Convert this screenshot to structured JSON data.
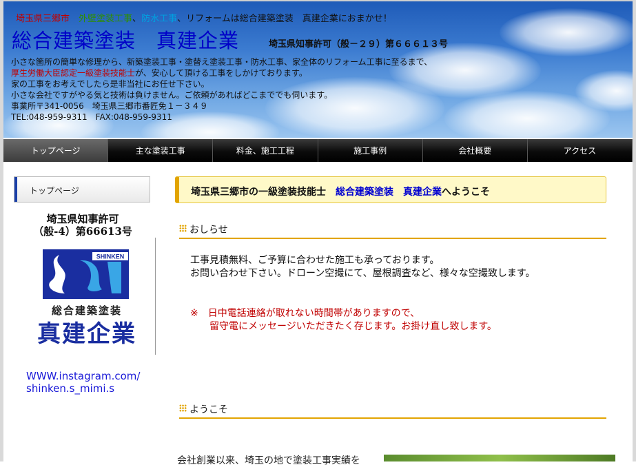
{
  "header": {
    "tagline": {
      "location": "埼玉県三郷市",
      "exterior": "外壁塗装工事",
      "waterproof": "防水工事",
      "rest": "、リフォームは総合建築塗装　真建企業におまかせ！"
    },
    "title": "総合建築塗装　真建企業",
    "license": "埼玉県知事許可（般－２９）第６６６１３号",
    "intro": {
      "line1": "小さな箇所の簡単な修理から、新築塗装工事・塗替え塗装工事・防水工事、家全体のリフォーム工事に至るまで、",
      "line2_red": "厚生労働大臣認定一級塗装技能士",
      "line2_rest": "が、安心して頂ける工事をしかけております。",
      "line3": "家の工事をお考えでしたら是非当社にお任せ下さい。",
      "line4": "小さな会社ですがやる気と技術は負けません。ご依頼があればどこまででも伺います。",
      "line5": "事業所〒341-0056　埼玉県三郷市番匠免１－３４９",
      "line6": "TEL:048-959-9311　FAX:048-959-9311"
    }
  },
  "nav": {
    "items": [
      {
        "label": "トップページ"
      },
      {
        "label": "主な塗装工事"
      },
      {
        "label": "料金、施工工程"
      },
      {
        "label": "施工事例"
      },
      {
        "label": "会社概要"
      },
      {
        "label": "アクセス"
      }
    ]
  },
  "sidebar": {
    "menu_item": "トップページ",
    "license_line1": "埼玉県知事許可",
    "license_line2": "（般-4）第66613号",
    "logo": {
      "brand": "SHINKEN",
      "subtitle": "総合建築塗装",
      "name": "真建企業"
    },
    "instagram_line1": "WWW.instagram.com/",
    "instagram_line2": "shinken.s_mimi.s"
  },
  "main": {
    "welcome": {
      "prefix": "埼玉県三郷市の一級塗装技能士　",
      "company": "総合建築塗装　真建企業",
      "suffix": "へようこそ"
    },
    "news_heading": "おしらせ",
    "notice_line1": "工事見積無料、ご予算に合わせた施工も承っております。",
    "notice_line2": "お問い合わせ下さい。ドローン空撮にて、屋根調査など、様々な空撮致します。",
    "warn_line1": "※　日中電話連絡が取れない時間帯がありますので、",
    "warn_line2": "　　留守電にメッセージいただきたく存じます。お掛け直し致します。",
    "welcome_heading": "ようこそ",
    "partial_text": "会社創業以来、埼玉の地で塗装工事実績を"
  },
  "colors": {
    "title_blue": "#0000c8",
    "accent_orange": "#e2a400",
    "warn_red": "#c00000",
    "nav_black": "#000000",
    "link_blue": "#1a1ad8"
  }
}
